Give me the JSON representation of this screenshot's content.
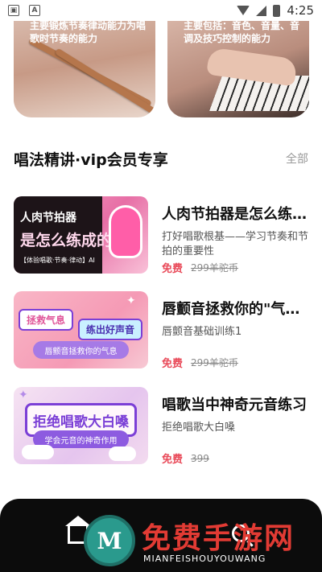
{
  "status_bar": {
    "time": "4:25",
    "left_icons": [
      "image-icon",
      "font-icon"
    ],
    "right_icons": [
      "wifi-icon",
      "signal-icon",
      "battery-icon"
    ]
  },
  "top_cards": [
    {
      "desc": "主要锻炼节奏律动能力为唱歌时节奏的能力"
    },
    {
      "desc": "主要包括：音色、音量、音调及技巧控制的能力"
    }
  ],
  "section": {
    "title": "唱法精讲·vip会员专享",
    "more": "全部"
  },
  "courses": [
    {
      "title": "人肉节拍器是怎么练成的",
      "desc": "打好唱歌根基——学习节奏和节拍的重要性",
      "price_free": "免费",
      "price_old": "299羊驼币",
      "thumb_line1": "人肉节拍器",
      "thumb_line2": "是怎么练成的",
      "thumb_tag": "【体验唱歌·节奏·律动】AI"
    },
    {
      "title": "唇颤音拯救你的\"气息\"",
      "desc": "唇颤音基础训练1",
      "price_free": "免费",
      "price_old": "299羊驼币",
      "thumb_tag1": "拯救气息",
      "thumb_tag2": "练出好声音",
      "thumb_banner": "唇颤音拯救你的气息"
    },
    {
      "title": " 唱歌当中神奇元音练习",
      "desc": "拒绝唱歌大白嗓",
      "price_free": "免费",
      "price_old": "399",
      "thumb_box": "拒绝唱歌大白嗓",
      "thumb_banner": "学会元音的神奇作用"
    }
  ],
  "watermark": {
    "logo_letter": "M",
    "title": "免费手游网",
    "subtitle": "MIANFEISHOUYOUWANG"
  },
  "colors": {
    "accent_price": "#e94b5a",
    "bottom_bar": "#0c0c0c"
  }
}
